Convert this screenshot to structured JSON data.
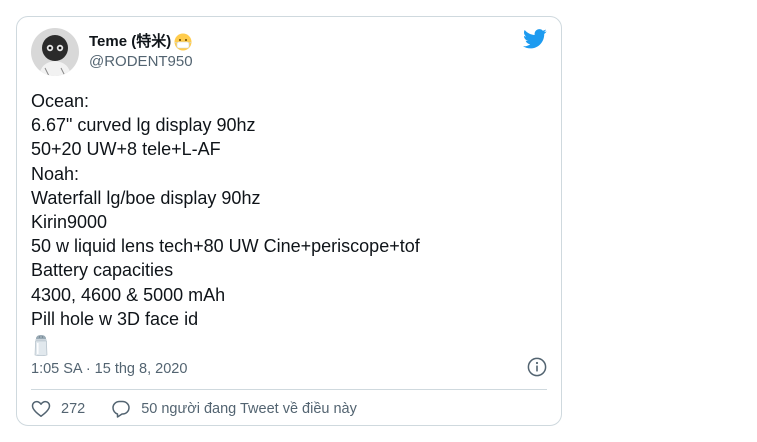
{
  "tweet": {
    "author": {
      "display_name": "Teme (特米)",
      "handle": "@RODENT950",
      "name_emoji": "face-with-medical-mask"
    },
    "lines": [
      "Ocean:",
      "6.67\" curved lg display 90hz",
      "50+20 UW+8 tele+L-AF",
      "Noah:",
      "Waterfall lg/boe display 90hz",
      "Kirin9000",
      "50 w liquid lens tech+80 UW Cine+periscope+tof",
      "Battery capacities",
      "4300, 4600 & 5000 mAh",
      "Pill hole w 3D face id"
    ],
    "trailing_emoji": "salt-shaker",
    "timestamp": "1:05 SA · 15 thg 8, 2020",
    "likes": "272",
    "reply_text": "50 người đang Tweet về điều này"
  },
  "icons": {
    "brand": "twitter-bird",
    "info": "info-circle",
    "like": "heart-outline",
    "reply": "speech-bubble"
  },
  "colors": {
    "twitter_blue": "#1d9bf0",
    "text_primary": "#0f1419",
    "text_secondary": "#536471",
    "border": "#cfd9de"
  }
}
